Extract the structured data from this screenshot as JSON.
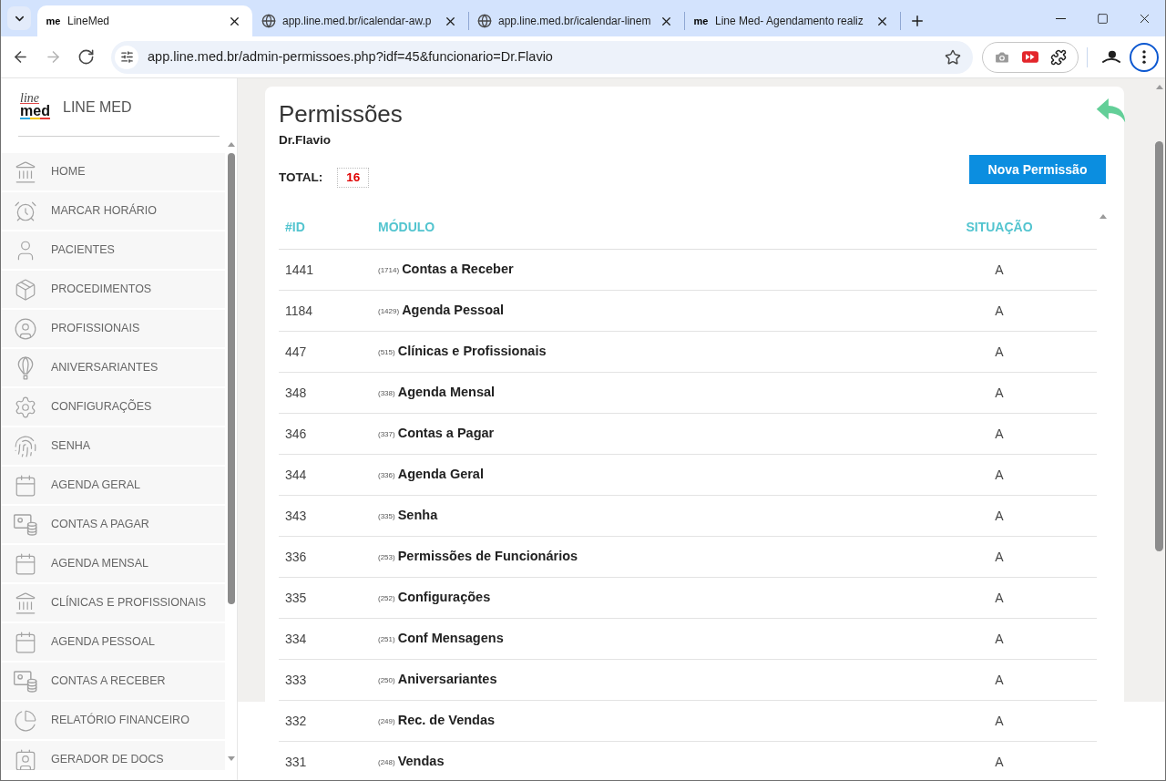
{
  "browser": {
    "tabs": [
      {
        "favicon": "me",
        "title": "LineMed",
        "selected": true
      },
      {
        "title": "app.line.med.br/icalendar-aw.p",
        "selected": false
      },
      {
        "title": "app.line.med.br/icalendar-linem",
        "selected": false
      },
      {
        "favicon": "me",
        "title": "Line Med- Agendamento realiz",
        "selected": false
      }
    ],
    "nav_buttons": [
      {
        "kind": "back",
        "disabled": false
      },
      {
        "kind": "forward",
        "disabled": true
      },
      {
        "kind": "reload",
        "disabled": false
      }
    ],
    "url": "app.line.med.br/admin-permissoes.php?idf=45&funcionario=Dr.Flavio"
  },
  "sidebar": {
    "logo": {
      "top": "line",
      "bottom": "med"
    },
    "brand": "LINE MED",
    "items": [
      {
        "label": "HOME"
      },
      {
        "label": "MARCAR HORÁRIO"
      },
      {
        "label": "PACIENTES"
      },
      {
        "label": "PROCEDIMENTOS"
      },
      {
        "label": "PROFISSIONAIS"
      },
      {
        "label": "ANIVERSARIANTES"
      },
      {
        "label": "CONFIGURAÇÕES"
      },
      {
        "label": "SENHA"
      },
      {
        "label": "AGENDA GERAL"
      },
      {
        "label": "CONTAS A PAGAR"
      },
      {
        "label": "AGENDA MENSAL"
      },
      {
        "label": "CLÍNICAS E PROFISSIONAIS"
      },
      {
        "label": "AGENDA PESSOAL"
      },
      {
        "label": "CONTAS A RECEBER"
      },
      {
        "label": "RELATÓRIO FINANCEIRO"
      },
      {
        "label": "GERADOR DE DOCS"
      }
    ]
  },
  "header": {
    "title": "Permissões",
    "subtitle": "Dr.Flavio",
    "total_label": "TOTAL:",
    "total_value": "16",
    "button": "Nova Permissão"
  },
  "table": {
    "columns": [
      "#ID",
      "MÓDULO",
      "SITUAÇÃO"
    ],
    "rows": [
      {
        "id": "1441",
        "code": "(1714)",
        "module": "Contas a Receber",
        "status": "A"
      },
      {
        "id": "1184",
        "code": "(1429)",
        "module": "Agenda Pessoal",
        "status": "A"
      },
      {
        "id": "447",
        "code": "(515)",
        "module": "Clínicas e Profissionais",
        "status": "A"
      },
      {
        "id": "348",
        "code": "(338)",
        "module": "Agenda Mensal",
        "status": "A"
      },
      {
        "id": "346",
        "code": "(337)",
        "module": "Contas a Pagar",
        "status": "A"
      },
      {
        "id": "344",
        "code": "(336)",
        "module": "Agenda Geral",
        "status": "A"
      },
      {
        "id": "343",
        "code": "(335)",
        "module": "Senha",
        "status": "A"
      },
      {
        "id": "336",
        "code": "(253)",
        "module": "Permissões de Funcionários",
        "status": "A"
      },
      {
        "id": "335",
        "code": "(252)",
        "module": "Configurações",
        "status": "A"
      },
      {
        "id": "334",
        "code": "(251)",
        "module": "Conf Mensagens",
        "status": "A"
      },
      {
        "id": "333",
        "code": "(250)",
        "module": "Aniversariantes",
        "status": "A"
      },
      {
        "id": "332",
        "code": "(249)",
        "module": "Rec. de Vendas",
        "status": "A"
      },
      {
        "id": "331",
        "code": "(248)",
        "module": "Vendas",
        "status": "A"
      }
    ]
  }
}
